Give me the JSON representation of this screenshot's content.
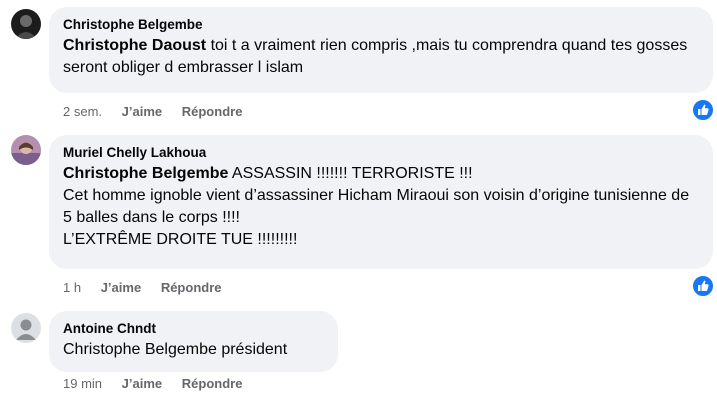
{
  "comments": [
    {
      "author": "Christophe Belgembe",
      "mention": "Christophe Daoust",
      "text": " toi t a vraiment rien compris ,mais tu comprendra quand tes gosses seront obliger d embrasser l islam",
      "time": "2 sem.",
      "like": "J’aime",
      "reply": "Répondre"
    },
    {
      "author": "Muriel Chelly Lakhoua",
      "mention": "Christophe Belgembe",
      "text": " ASSASSIN !!!!!!! TERRORISTE !!!\nCet homme ignoble vient d’assassiner Hicham Miraoui son voisin d’origine tunisienne de 5 balles dans le corps !!!!\nL’EXTRÊME DROITE TUE !!!!!!!!!",
      "time": "1 h",
      "like": "J’aime",
      "reply": "Répondre"
    },
    {
      "author": "Antoine Chndt",
      "mention": "",
      "text": "Christophe Belgembe président",
      "time": "19 min",
      "like": "J’aime",
      "reply": "Répondre"
    }
  ],
  "icons": {
    "reaction": "like-reaction-icon",
    "avatar_default": "default-avatar-icon"
  },
  "colors": {
    "bubble": "#f0f2f5",
    "meta_text": "#65676b",
    "like_blue": "#1877f2"
  }
}
